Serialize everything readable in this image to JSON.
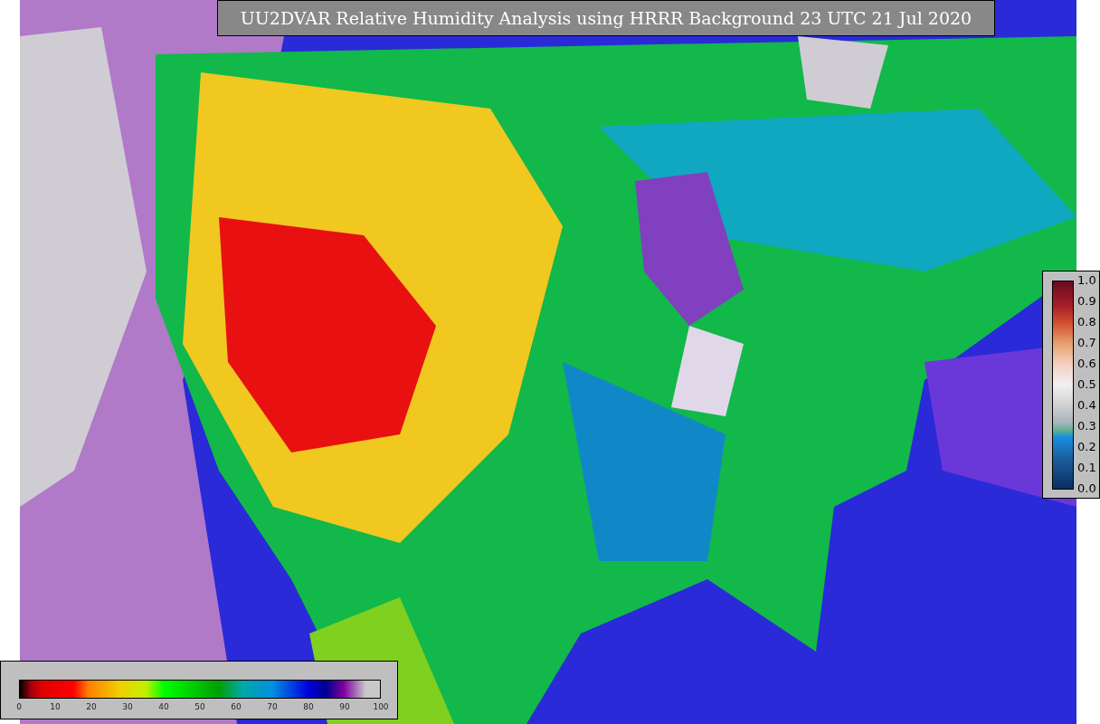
{
  "title": "UU2DVAR Relative Humidity Analysis using HRRR Background 23 UTC 21 Jul 2020",
  "humidity_colorbar": {
    "ticks": [
      "0",
      "10",
      "20",
      "30",
      "40",
      "50",
      "60",
      "70",
      "80",
      "90",
      "100"
    ]
  },
  "station_colorbar": {
    "ticks": [
      "1.0",
      "0.9",
      "0.8",
      "0.7",
      "0.6",
      "0.5",
      "0.4",
      "0.3",
      "0.2",
      "0.1",
      "0.0"
    ]
  }
}
